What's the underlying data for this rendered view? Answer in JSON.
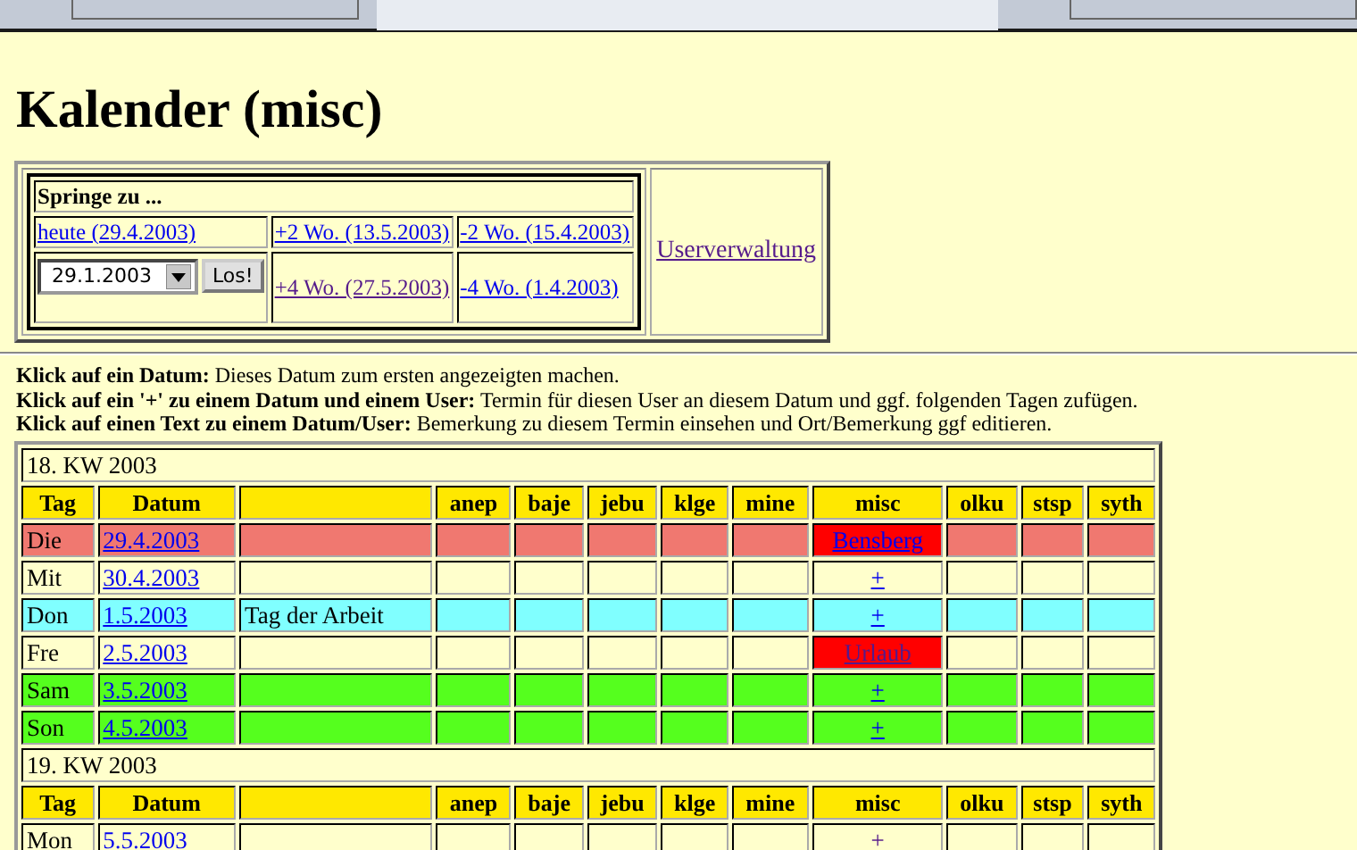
{
  "browser_tabs": [
    {
      "selected": false
    },
    {
      "selected": true
    },
    {
      "selected": false
    }
  ],
  "title": "Kalender (misc)",
  "jump": {
    "heading": "Springe zu ...",
    "links": [
      {
        "text": "heute (29.4.2003)",
        "visited": false
      },
      {
        "text": "+2 Wo. (13.5.2003)",
        "visited": false
      },
      {
        "text": "-2 Wo. (15.4.2003)",
        "visited": false
      }
    ],
    "date_select": {
      "value": "29.1.2003"
    },
    "go_button": "Los!",
    "links2": [
      {
        "text": "+4 Wo. (27.5.2003)",
        "visited": true
      },
      {
        "text": "-4 Wo. (1.4.2003)",
        "visited": false
      }
    ],
    "admin_link": {
      "text": "Userverwaltung",
      "visited": true
    }
  },
  "help": [
    {
      "bold": "Klick auf ein Datum:",
      "text": "Dieses Datum zum ersten angezeigten machen."
    },
    {
      "bold": "Klick auf ein '+' zu einem Datum und einem User:",
      "text": "Termin für diesen User an diesem Datum und ggf. folgenden Tagen zufügen."
    },
    {
      "bold": "Klick auf einen Text zu einem Datum/User:",
      "text": "Bemerkung zu diesem Termin einsehen und Ort/Bemerkung ggf editieren."
    }
  ],
  "weeks": [
    {
      "title": "18. KW 2003",
      "columns": [
        "Tag",
        "Datum",
        "anep",
        "baje",
        "jebu",
        "klge",
        "mine",
        "misc",
        "olku",
        "stsp",
        "syth"
      ],
      "rows": [
        {
          "day": "Die",
          "date": "29.4.2003",
          "color": "#f07870",
          "misc": {
            "kind": "entry",
            "text": "Bensberg",
            "color": "#ff0000",
            "visited": false
          }
        },
        {
          "day": "Mit",
          "date": "30.4.2003",
          "color": "#ffffcc",
          "misc": {
            "kind": "add",
            "text": "+",
            "visited": false
          }
        },
        {
          "day": "Don",
          "date": "1.5.2003",
          "holiday": "Tag der Arbeit",
          "color": "#80ffff",
          "misc": {
            "kind": "add",
            "text": "+",
            "visited": false
          }
        },
        {
          "day": "Fre",
          "date": "2.5.2003",
          "color": "#ffffcc",
          "misc": {
            "kind": "entry",
            "text": "Urlaub",
            "color": "#ff0000",
            "visited": true
          }
        },
        {
          "day": "Sam",
          "date": "3.5.2003",
          "color": "#55ff1e",
          "misc": {
            "kind": "add",
            "text": "+",
            "visited": false
          }
        },
        {
          "day": "Son",
          "date": "4.5.2003",
          "color": "#55ff1e",
          "misc": {
            "kind": "add",
            "text": "+",
            "visited": false
          }
        }
      ]
    },
    {
      "title": "19. KW 2003",
      "columns": [
        "Tag",
        "Datum",
        "anep",
        "baje",
        "jebu",
        "klge",
        "mine",
        "misc",
        "olku",
        "stsp",
        "syth"
      ],
      "rows": [
        {
          "day": "Mon",
          "date": "5.5.2003",
          "color": "#ffffcc",
          "misc": {
            "kind": "add",
            "text": "+",
            "visited": true
          }
        }
      ]
    }
  ]
}
